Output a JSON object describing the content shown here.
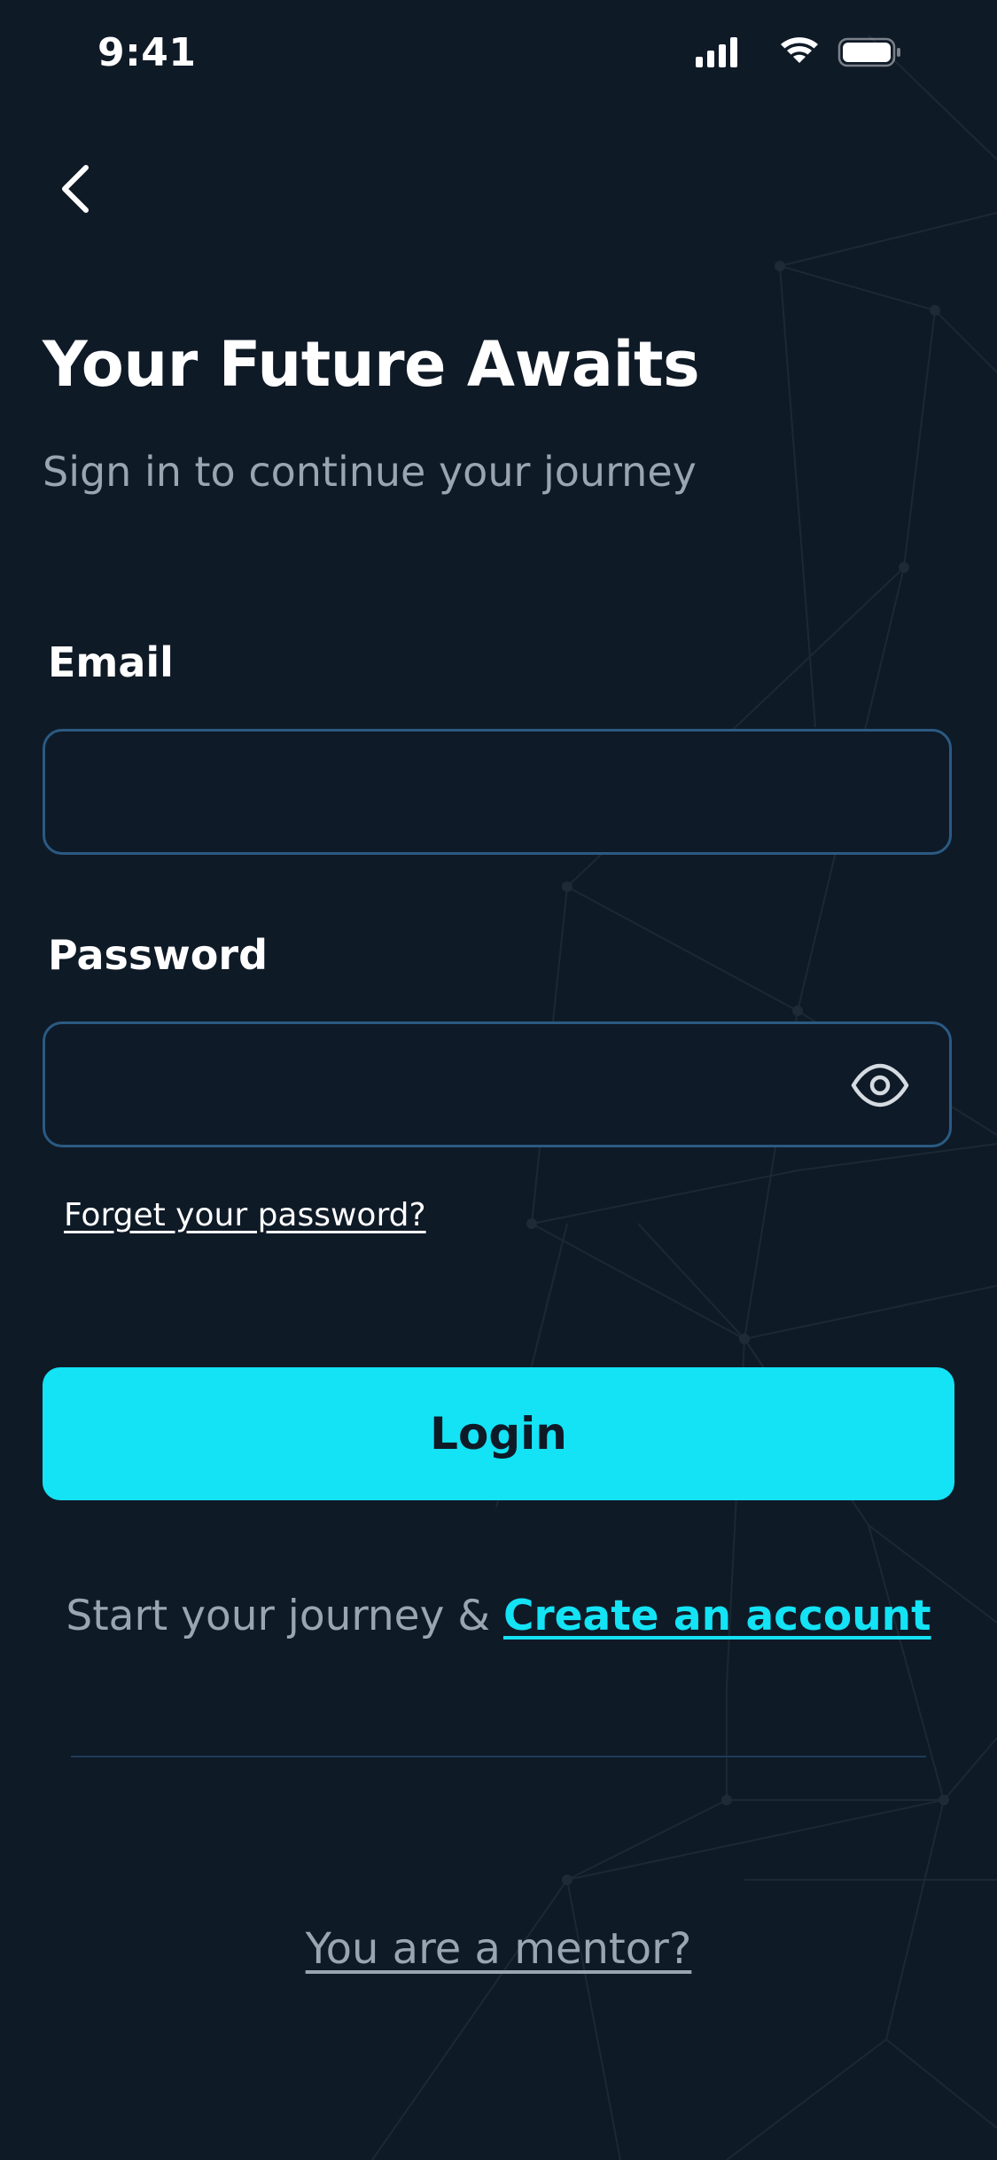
{
  "status_bar": {
    "time": "9:41"
  },
  "header": {
    "back_icon": "chevron-left-icon",
    "title": "Your Future Awaits",
    "subtitle": "Sign in to continue your journey"
  },
  "form": {
    "email": {
      "label": "Email",
      "value": "",
      "placeholder": ""
    },
    "password": {
      "label": "Password",
      "value": "",
      "placeholder": "",
      "toggle_icon": "eye-icon"
    },
    "forgot_link": "Forget your password?",
    "login_label": "Login"
  },
  "signup": {
    "prompt": "Start your journey & ",
    "link": "Create an account"
  },
  "mentor_link": "You are a mentor?",
  "colors": {
    "background": "#0f1a27",
    "accent": "#13e3f5",
    "input_border": "#2a5a82",
    "muted_text": "#9aa5b1"
  }
}
